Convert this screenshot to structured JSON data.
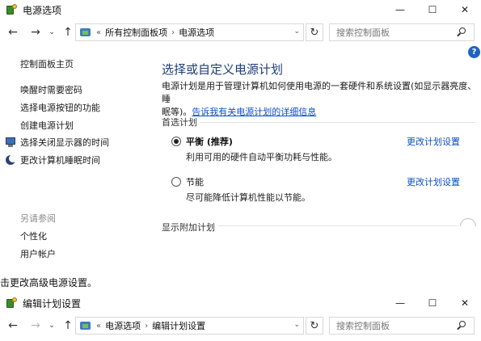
{
  "window1": {
    "title": "电源选项",
    "controls": {
      "minimize": "—",
      "maximize": "☐",
      "close": "✕"
    },
    "nav": {
      "back": "←",
      "forward": "→",
      "recent": "⌄",
      "up": "↑"
    },
    "breadcrumb": {
      "overflow": "«",
      "items": [
        "所有控制面板项",
        "电源选项"
      ]
    },
    "address_dropdown": "⌄",
    "refresh": "↻",
    "search": {
      "placeholder": "搜索控制面板"
    },
    "help": "?",
    "sidebar": {
      "links": [
        "控制面板主页",
        "唤醒时需要密码",
        "选择电源按钮的功能",
        "创建电源计划",
        "选择关闭显示器的时间",
        "更改计算机睡眠时间"
      ],
      "see_also_heading": "另请参阅",
      "see_also": [
        "个性化",
        "用户帐户"
      ]
    },
    "main": {
      "title": "选择或自定义电源计划",
      "desc_line1": "电源计划是用于管理计算机如何使用电源的一套硬件和系统设置(如显示器亮度、睡",
      "desc_line2_prefix": "眠等)。",
      "desc_link": "告诉我有关电源计划的详细信息",
      "preferred_heading": "首选计划",
      "plans": [
        {
          "name": "平衡 (推荐)",
          "desc": "利用可用的硬件自动平衡功耗与性能。",
          "link": "更改计划设置",
          "selected": true
        },
        {
          "name": "节能",
          "desc": "尽可能降低计算机性能以节能。",
          "link": "更改计划设置",
          "selected": false
        }
      ],
      "additional_heading": "显示附加计划"
    }
  },
  "caption": "击更改高级电源设置。",
  "window2": {
    "title": "编辑计划设置",
    "controls": {
      "minimize": "—",
      "maximize": "☐",
      "close": "✕"
    },
    "nav": {
      "back": "←",
      "forward": "→",
      "recent": "⌄",
      "up": "↑"
    },
    "breadcrumb": {
      "overflow": "«",
      "items": [
        "电源选项",
        "编辑计划设置"
      ]
    },
    "address_dropdown": "⌄",
    "refresh": "↻",
    "search": {
      "placeholder": "搜索控制面板"
    }
  }
}
